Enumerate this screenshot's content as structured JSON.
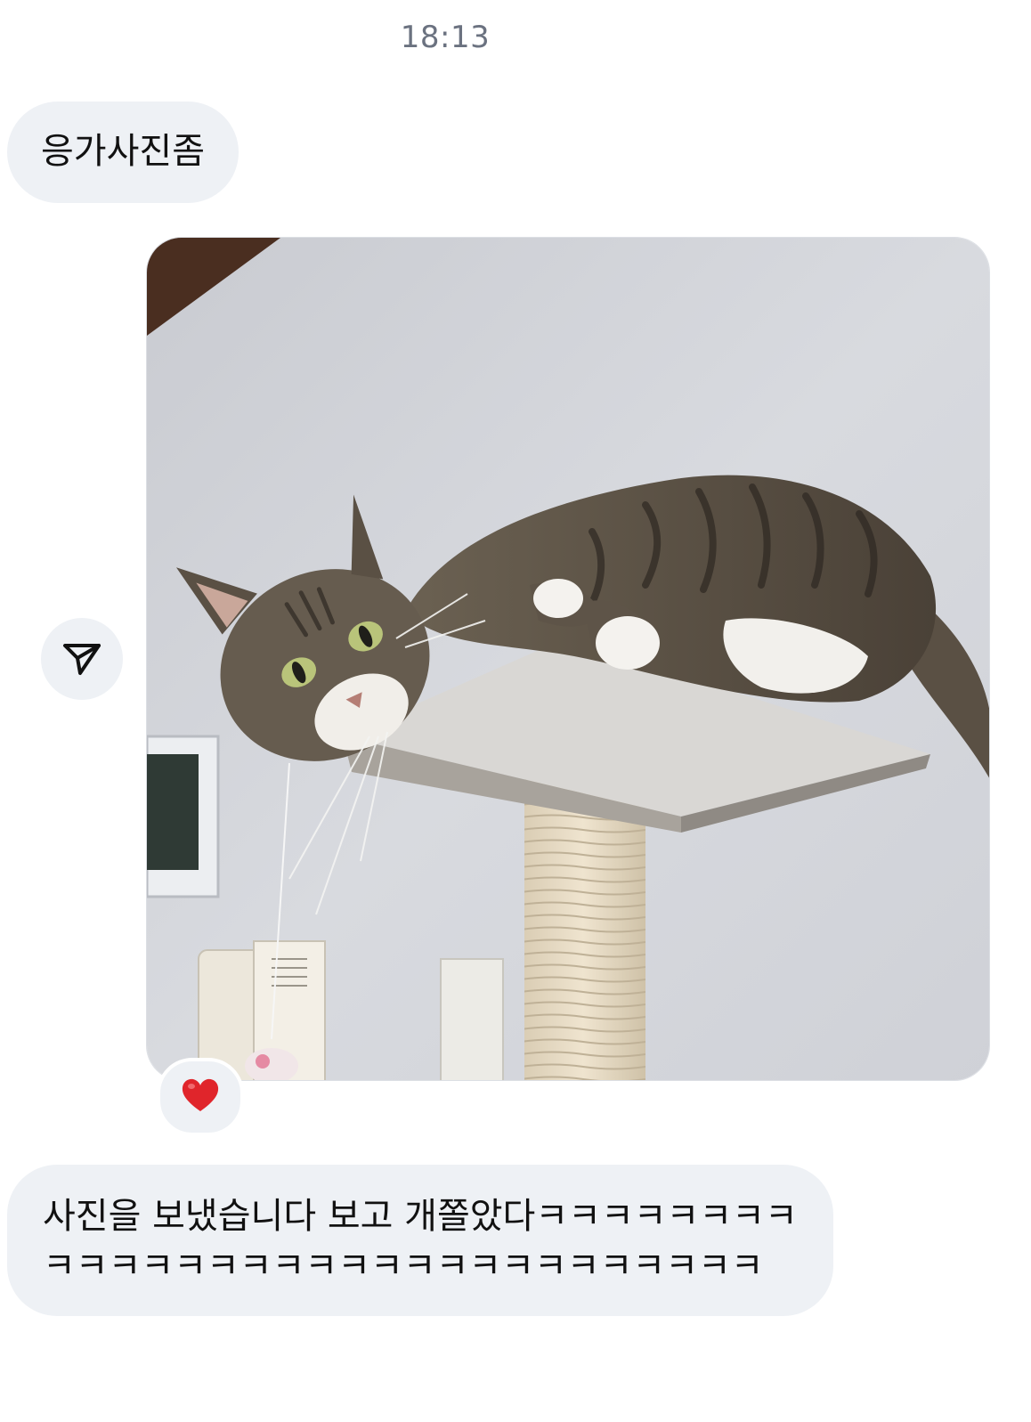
{
  "header": {
    "timestamp": "18:13"
  },
  "messages": {
    "incoming_1": {
      "text": "응가사진좀"
    },
    "photo": {
      "reaction_icon": "heart-icon",
      "reaction_color": "#e0252b"
    },
    "incoming_2": {
      "text": "사진을 보냈습니다 보고 개쫄았다ㅋㅋㅋㅋㅋㅋㅋㅋㅋㅋㅋㅋㅋㅋㅋㅋㅋㅋㅋㅋㅋㅋㅋㅋㅋㅋㅋㅋㅋㅋ"
    }
  },
  "actions": {
    "share_icon": "send-icon"
  },
  "colors": {
    "bubble_background": "#eef1f5",
    "timestamp_text": "#6b7280"
  }
}
